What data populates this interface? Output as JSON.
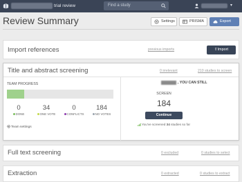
{
  "topbar": {
    "project_suffix": "trial review",
    "search_placeholder": "Find a study",
    "user_caret": "▾"
  },
  "header": {
    "title": "Review Summary",
    "settings_label": "Settings",
    "prisma_label": "PRISMA",
    "export_label": "Export"
  },
  "import_card": {
    "title": "Import references",
    "previous_imports": "previous imports",
    "import_button": "Import"
  },
  "screening_card": {
    "title": "Title and abstract screening",
    "irrelevant_link": "0 irrelevant",
    "studies_to_screen_link": "210 studies to screen",
    "team_progress_label": "TEAM PROGRESS",
    "progress_fraction": 0.16,
    "stats": [
      {
        "value": "0",
        "label": "DONE",
        "color": "#7dbf5f"
      },
      {
        "value": "34",
        "label": "ONE VOTE",
        "color": "#c3d94a"
      },
      {
        "value": "0",
        "label": "CONFLICTS",
        "color": "#8e3bb0"
      },
      {
        "value": "184",
        "label": "NO VOTES",
        "color": "#9aa3ad"
      }
    ],
    "team_settings_label": "Team settings",
    "can_still_label": ", YOU CAN STILL",
    "screen_label": "SCREEN",
    "screen_count": "184",
    "continue_label": "Continue",
    "screened_prefix": "You've screened ",
    "screened_count": "34",
    "screened_suffix": " studies so far"
  },
  "full_text_card": {
    "title": "Full text screening",
    "excluded_link": "0 excluded",
    "select_link": "0 studies to select"
  },
  "extraction_card": {
    "title": "Extraction",
    "extracted_link": "0 extracted",
    "extract_link": "0 studies to extract"
  },
  "colors": {
    "topbar": "#3a4456",
    "export_button": "#5f80b5",
    "import_button": "#384457",
    "continue_button": "#3d4a5f",
    "progress_fill": "#9fd18c"
  }
}
